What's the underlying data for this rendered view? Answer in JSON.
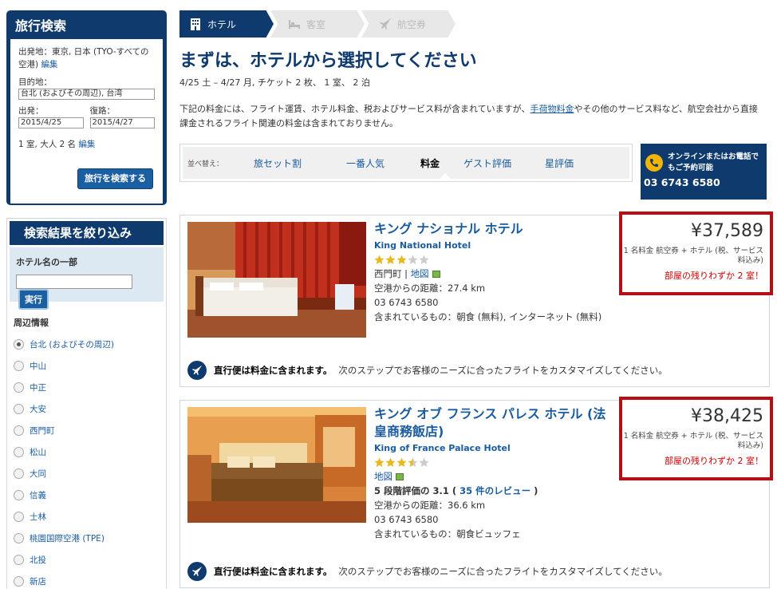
{
  "search": {
    "title": "旅行検索",
    "origin_label": "出発地：東京, 日本 (TYO-すべての空港)",
    "origin_edit": "編集",
    "dest_label": "目的地：",
    "dest_value": "台北 (およびその周辺), 台湾",
    "depart_label": "出発：",
    "depart_value": "2015/4/25",
    "return_label": "復路：",
    "return_value": "2015/4/27",
    "rooms_label": "1 室, 大人 2 名",
    "rooms_edit": "編集",
    "search_button": "旅行を検索する"
  },
  "filter": {
    "title": "検索結果を絞り込み",
    "hotel_name_label": "ホテル名の一部",
    "go_button": "実行",
    "area_title": "周辺情報",
    "areas": [
      "台北 (およびその周辺)",
      "中山",
      "中正",
      "大安",
      "西門町",
      "松山",
      "大同",
      "信義",
      "士林",
      "桃園国際空港 (TPE)",
      "北投",
      "新店"
    ]
  },
  "steps": [
    "ホテル",
    "客室",
    "航空券"
  ],
  "main": {
    "title": "まずは、ホテルから選択してください",
    "trip_info": "4/25 土 – 4/27 月, チケット 2 枚、 1 室、 2 泊",
    "notice_pre": "下記の料金には、フライト運賃、ホテル料金、税およびサービス料が含まれていますが、",
    "notice_link": "手荷物料金",
    "notice_post": "やその他のサービス料など、航空会社から直接課金されるフライト関連の料金は含まれておりません。"
  },
  "sort": {
    "label": "並べ替え：",
    "items": [
      "旅セット割",
      "一番人気",
      "料金",
      "ゲスト評価",
      "星評価"
    ]
  },
  "phone": {
    "text": "オンラインまたはお電話でもご予約可能",
    "number": "03 6743 6580"
  },
  "hotels": [
    {
      "name": "キング ナショナル ホテル",
      "name_en": "King National Hotel",
      "stars": 3,
      "area": "西門町",
      "map": "地図",
      "distance": "空港からの距離：27.4 km",
      "phone": "03 6743 6580",
      "included": "含まれているもの：朝食 (無料), インターネット (無料)",
      "price": "¥37,589",
      "price_note": "1 名料金  航空券 + ホテル (税、サービス料込み)",
      "rooms_left": "部屋の残りわずか 2 室！",
      "flight_bold": "直行便は料金に含まれます。",
      "flight_text": "次のステップでお客様のニーズに合ったフライトをカスタマイズしてください。"
    },
    {
      "name": "キング オブ フランス パレス ホテル (法皇商務飯店)",
      "name_en": "King of France Palace Hotel",
      "stars": 3.5,
      "map": "地図",
      "rating": "5 段階評価の 3.1",
      "reviews": "35 件のレビュー",
      "distance": "空港からの距離：36.6 km",
      "phone": "03 6743 6580",
      "included": "含まれているもの：朝食ビュッフェ",
      "price": "¥38,425",
      "price_note": "1 名料金  航空券 + ホテル (税、サービス料込み)",
      "rooms_left": "部屋の残りわずか 2 室！",
      "flight_bold": "直行便は料金に含まれます。",
      "flight_text": "次のステップでお客様のニーズに合ったフライトをカスタマイズしてください。"
    }
  ],
  "colors": {
    "navy": "#0f3a6e",
    "link": "#1a5ca0",
    "highlight_border": "#b70d14",
    "star": "#e8b81c"
  }
}
